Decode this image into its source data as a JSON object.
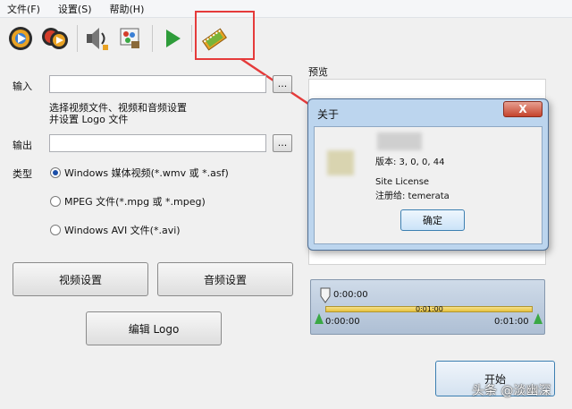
{
  "menu": {
    "file": "文件(F)",
    "settings": "设置(S)",
    "help": "帮助(H)"
  },
  "form": {
    "input_label": "输入",
    "input_value": "",
    "browse_label": "...",
    "hint_line1": "选择视频文件、视频和音频设置",
    "hint_line2": "并设置 Logo 文件",
    "output_label": "输出",
    "output_value": "",
    "type_label": "类型",
    "options": [
      {
        "label": "Windows 媒体视频(*.wmv 或 *.asf)",
        "selected": true
      },
      {
        "label": "MPEG 文件(*.mpg 或 *.mpeg)",
        "selected": false
      },
      {
        "label": "Windows AVI 文件(*.avi)",
        "selected": false
      }
    ],
    "video_settings": "视频设置",
    "audio_settings": "音频设置",
    "edit_logo": "编辑 Logo"
  },
  "preview": {
    "label": "预览"
  },
  "about_dialog": {
    "title": "关于",
    "close": "X",
    "version": "版本: 3, 0, 0, 44",
    "license": "Site License",
    "registered": "注册给: temerata",
    "ok": "确定"
  },
  "timeline": {
    "marker_time": "0:00:00",
    "mid_time": "0:01:00",
    "start_time": "0:00:00",
    "end_time": "0:01:00"
  },
  "start_button": "开始",
  "watermark": "头条 @淡幽深",
  "colors": {
    "highlight": "#e53b3b",
    "dialog_frame": "#bcd5ee",
    "track": "#e6c23c"
  }
}
